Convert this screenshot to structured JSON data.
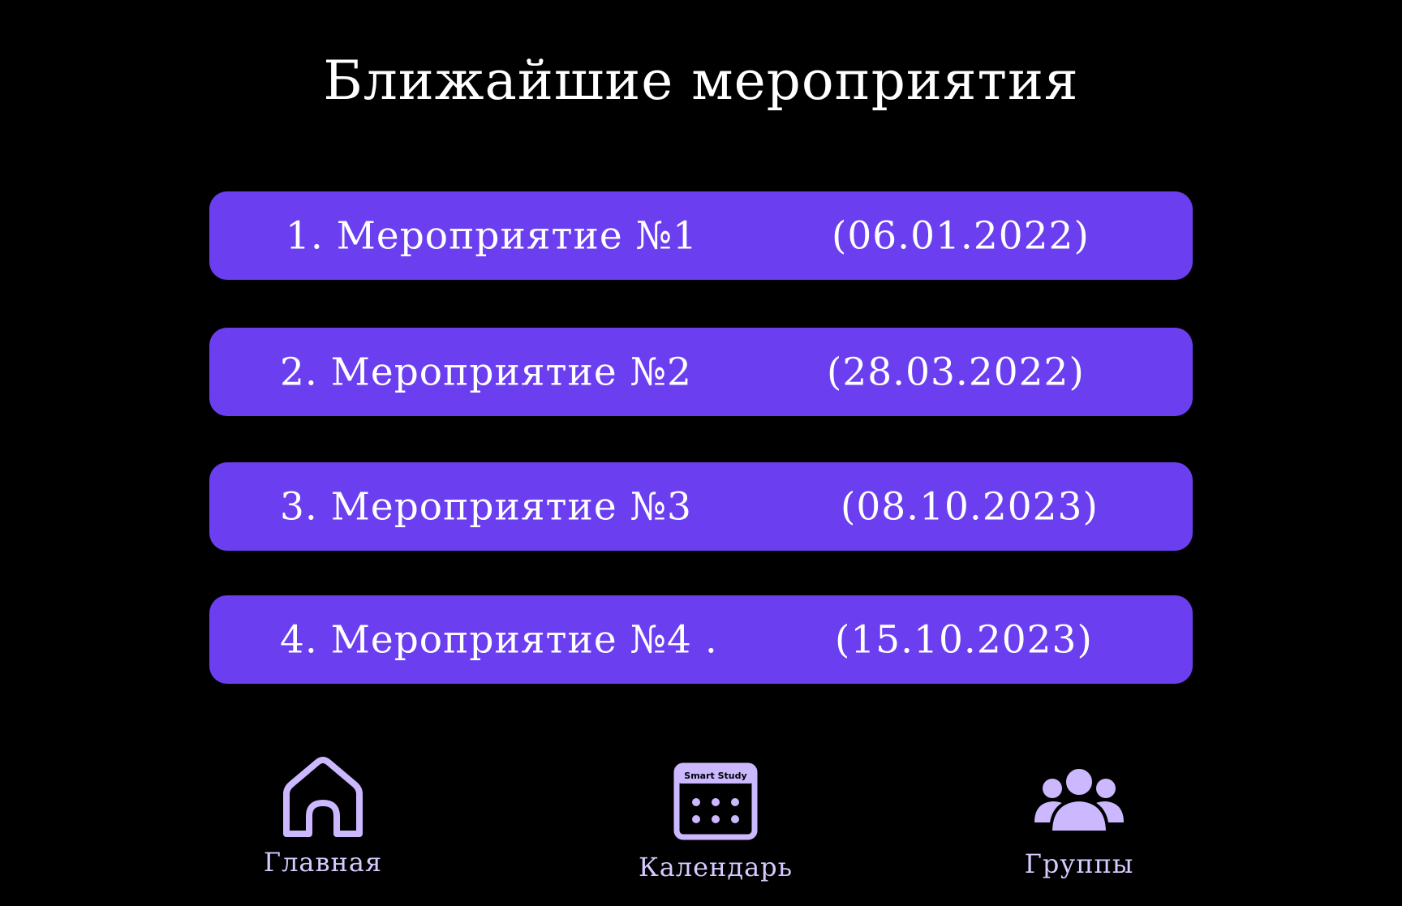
{
  "page": {
    "title": "Ближайшие мероприятия"
  },
  "events": [
    {
      "name": "1. Мероприятие №1",
      "date": "(06.01.2022)"
    },
    {
      "name": "2. Мероприятие №2",
      "date": "(28.03.2022)"
    },
    {
      "name": "3. Мероприятие №3",
      "date": "(08.10.2023)"
    },
    {
      "name": "4. Мероприятие №4 .",
      "date": "(15.10.2023)"
    }
  ],
  "nav": {
    "home": {
      "label": "Главная",
      "icon": "home-icon"
    },
    "calendar": {
      "label": "Календарь",
      "icon": "calendar-icon",
      "brand": "Smart Study"
    },
    "groups": {
      "label": "Группы",
      "icon": "users-icon"
    }
  },
  "colors": {
    "background": "#000000",
    "card": "#6b3ff0",
    "nav_accent": "#cbb8ff",
    "text": "#ffffff"
  }
}
